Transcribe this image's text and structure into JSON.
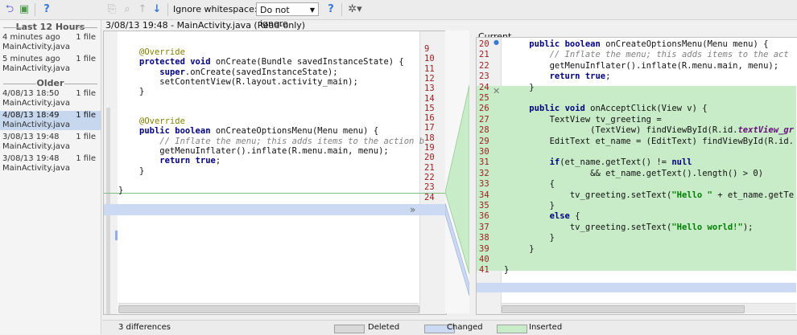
{
  "toolbar": {
    "ignore_label": "Ignore whitespace:",
    "ignore_value": "Do not ignore",
    "help_glyph": "?",
    "icons": [
      "revert-icon",
      "history-icon",
      "help-icon",
      "copy-icon",
      "find-icon",
      "previous-diff-icon",
      "next-diff-icon",
      "help-icon",
      "settings-icon"
    ]
  },
  "sidebar": {
    "groups": [
      {
        "header": "Last 12 Hours",
        "items": [
          {
            "time": "4 minutes ago",
            "count": "1 file",
            "file": "MainActivity.java",
            "selected": false
          },
          {
            "time": "5 minutes ago",
            "count": "1 file",
            "file": "MainActivity.java",
            "selected": false
          }
        ]
      },
      {
        "header": "Older",
        "items": [
          {
            "time": "4/08/13 18:50",
            "count": "1 file",
            "file": "MainActivity.java",
            "selected": false
          },
          {
            "time": "4/08/13 18:49",
            "count": "1 file",
            "file": "MainActivity.java",
            "selected": true
          },
          {
            "time": "3/08/13 19:48",
            "count": "1 file",
            "file": "MainActivity.java",
            "selected": false
          },
          {
            "time": "3/08/13 19:48",
            "count": "1 file",
            "file": "MainActivity.java",
            "selected": false
          }
        ]
      }
    ]
  },
  "left_panel": {
    "title": "3/08/13 19:48 - MainActivity.java (Read-only)",
    "gutter_numbers": [
      "9",
      "10",
      "11",
      "12",
      "13",
      "14",
      "15",
      "16",
      "17",
      "18",
      "19",
      "20",
      "21",
      "22",
      "23",
      "24"
    ],
    "lines": [
      "@Override",
      "protected void onCreate(Bundle savedInstanceState) {",
      "    super.onCreate(savedInstanceState);",
      "    setContentView(R.layout.activity_main);",
      "}",
      "",
      "",
      "@Override",
      "public boolean onCreateOptionsMenu(Menu menu) {",
      "    // Inflate the menu; this adds items to the action b",
      "    getMenuInflater().inflate(R.menu.main, menu);",
      "    return true;",
      "}",
      "",
      "}"
    ]
  },
  "right_panel": {
    "title": "Current",
    "line_numbers": [
      "20",
      "21",
      "22",
      "23",
      "24",
      "25",
      "26",
      "27",
      "28",
      "29",
      "30",
      "31",
      "32",
      "33",
      "34",
      "35",
      "36",
      "37",
      "38",
      "39",
      "40",
      "41"
    ],
    "lines": [
      "    public boolean onCreateOptionsMenu(Menu menu) {",
      "        // Inflate the menu; this adds items to the act",
      "        getMenuInflater().inflate(R.menu.main, menu);",
      "        return true;",
      "    }",
      "",
      "    public void onAcceptClick(View v) {",
      "        TextView tv_greeting =",
      "                (TextView) findViewById(R.id.textView_gr",
      "        EditText et_name = (EditText) findViewById(R.id.",
      "",
      "        if(et_name.getText() != null",
      "                && et_name.getText().length() > 0)",
      "        {",
      "            tv_greeting.setText(\"Hello \" + et_name.getTe",
      "        }",
      "        else {",
      "            tv_greeting.setText(\"Hello world!\");",
      "        }",
      "    }",
      "",
      "}"
    ]
  },
  "status": {
    "differences": "3 differences",
    "legend": [
      {
        "label": "Deleted",
        "color": "#d9d9d9"
      },
      {
        "label": "Changed",
        "color": "#ccd9f2"
      },
      {
        "label": "Inserted",
        "color": "#c8ecc8"
      }
    ]
  },
  "colors": {
    "changed": "#ccd9f2",
    "inserted": "#c8ecc8",
    "line_number": "#9b1d1d"
  }
}
